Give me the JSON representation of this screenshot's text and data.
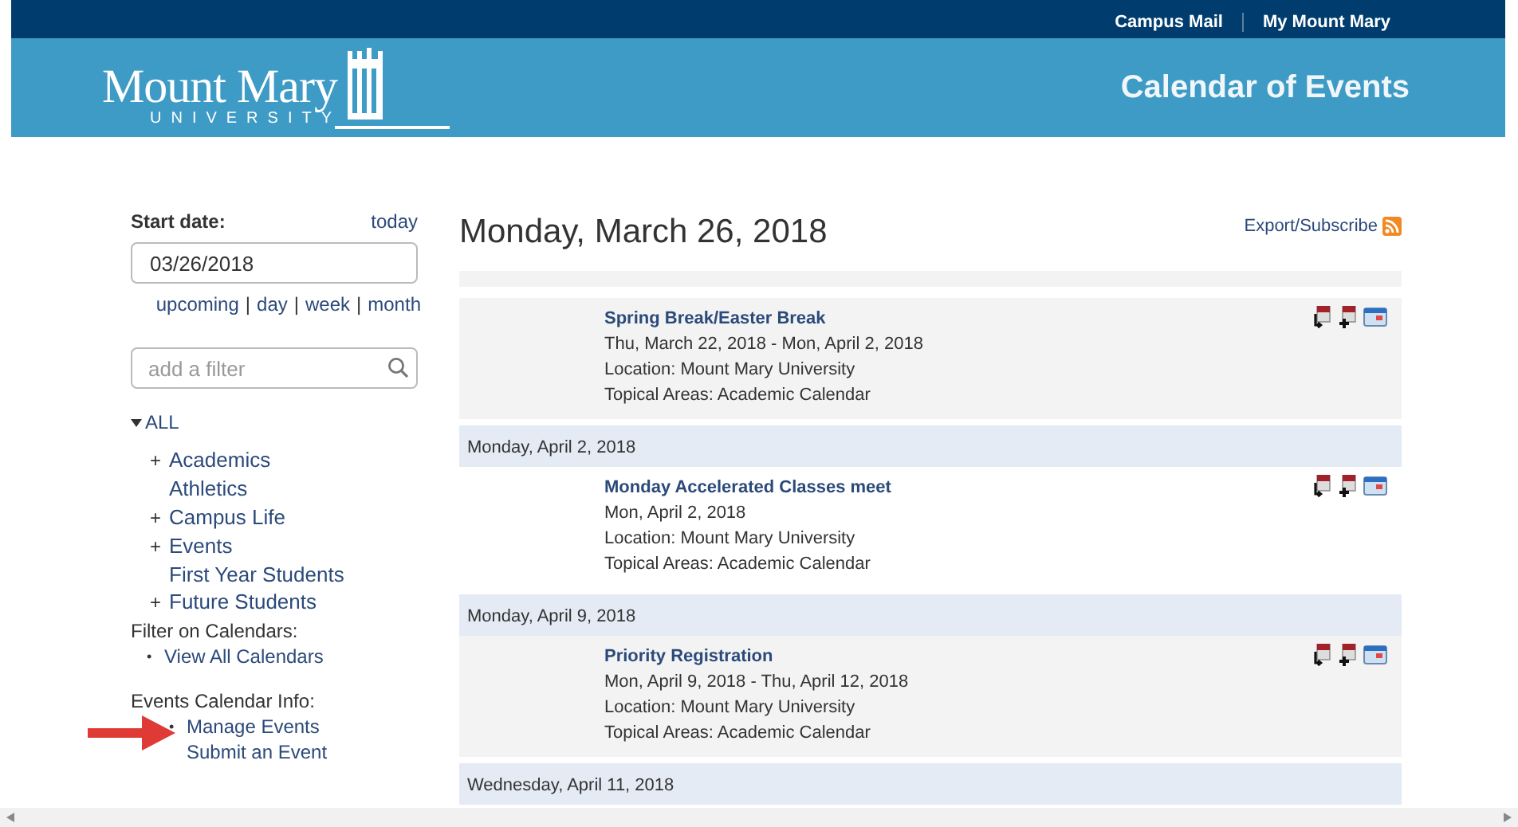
{
  "top_links": [
    "Campus Mail",
    "My Mount Mary"
  ],
  "logo": {
    "name": "Mount Mary",
    "sub": "UNIVERSITY"
  },
  "header_title": "Calendar of Events",
  "sidebar": {
    "start_label": "Start date:",
    "today": "today",
    "date_value": "03/26/2018",
    "ranges": [
      "upcoming",
      "day",
      "week",
      "month"
    ],
    "range_separator": "|",
    "filter_placeholder": "add a filter",
    "tree": {
      "label": "ALL",
      "expanded": true,
      "children": [
        {
          "label": "Academics",
          "toggle": "+"
        },
        {
          "label": "Athletics"
        },
        {
          "label": "Campus Life",
          "toggle": "+"
        },
        {
          "label": "Events",
          "toggle": "+"
        },
        {
          "label": "First Year Students"
        },
        {
          "label": "Future Students",
          "toggle": "+"
        }
      ]
    },
    "sections": [
      {
        "title": "Filter on Calendars:",
        "links": [
          {
            "text": "View All Calendars",
            "bullet": "•"
          }
        ]
      },
      {
        "title": "Events Calendar Info:",
        "links": [
          {
            "text": "Manage Events",
            "bullet": "•"
          },
          {
            "text": "Submit an Event"
          }
        ]
      }
    ]
  },
  "main": {
    "heading": "Monday, March 26, 2018",
    "export": "Export/Subscribe",
    "items": [
      {
        "kind": "event",
        "title": "Spring Break/Easter Break",
        "when": "Thu, March 22, 2018 - Mon, April 2, 2018",
        "location": "Location: Mount Mary University",
        "topics": "Topical Areas: Academic Calendar"
      },
      {
        "kind": "date",
        "label": "Monday, April 2, 2018"
      },
      {
        "kind": "event",
        "title": "Monday Accelerated Classes meet",
        "when": "Mon, April 2, 2018",
        "location": "Location: Mount Mary University",
        "topics": "Topical Areas: Academic Calendar"
      },
      {
        "kind": "date",
        "label": "Monday, April 9, 2018"
      },
      {
        "kind": "event",
        "title": "Priority Registration",
        "when": "Mon, April 9, 2018 - Thu, April 12, 2018",
        "location": "Location: Mount Mary University",
        "topics": "Topical Areas: Academic Calendar"
      },
      {
        "kind": "date",
        "label": "Wednesday, April 11, 2018"
      }
    ]
  }
}
